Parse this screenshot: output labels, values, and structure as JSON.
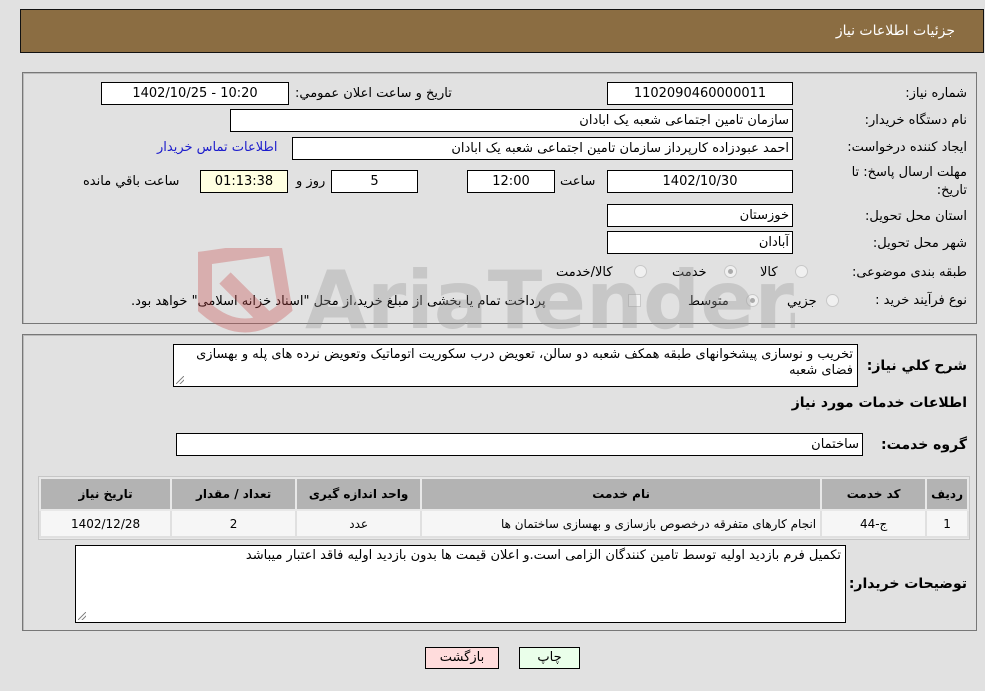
{
  "header": {
    "title": "جزئیات اطلاعات نیاز"
  },
  "form": {
    "need_number": {
      "label": "شماره نیاز:",
      "value": "1102090460000011"
    },
    "announce_datetime": {
      "label": "تاریخ و ساعت اعلان عمومي:",
      "value": "1402/10/25 - 10:20"
    },
    "buyer_org": {
      "label": "نام دستگاه خريدار:",
      "value": "سازمان تامین اجتماعی شعبه یک ابادان"
    },
    "requester": {
      "label": "ایجاد کننده درخواست:",
      "value": "احمد عبودزاده کارپرداز سازمان تامین اجتماعی شعبه یک ابادان"
    },
    "buyer_contact_link": "اطلاعات تماس خریدار",
    "deadline": {
      "label_line1": "مهلت ارسال پاسخ: تا",
      "label_line2": "تاریخ:",
      "date": "1402/10/30",
      "time_label": "ساعت",
      "time": "12:00",
      "days": "5",
      "days_label": "روز و",
      "remaining": "01:13:38",
      "remaining_label": "ساعت باقي مانده"
    },
    "province": {
      "label": "استان محل تحویل:",
      "value": "خوزستان"
    },
    "city": {
      "label": "شهر محل تحویل:",
      "value": "آبادان"
    },
    "category": {
      "label": "طبقه بندی موضوعی:",
      "options": [
        "کالا",
        "خدمت",
        "کالا/خدمت"
      ],
      "selected": "خدمت"
    },
    "process_type": {
      "label": "نوع فرآیند خرید :",
      "options": [
        "جزيي",
        "متوسط"
      ],
      "selected": "متوسط",
      "treasury_checkbox_label": "پرداخت تمام یا بخشی از مبلغ خرید،از محل \"اسناد خزانه اسلامی\" خواهد بود.",
      "treasury_checked": false
    }
  },
  "details": {
    "description_label": "شرح کلي نياز:",
    "description": "تخریب و نوسازی پیشخوانهای طبقه همکف شعبه دو سالن، تعویض درب سکوریت اتوماتیک وتعویض نرده های پله و بهسازی فضای شعبه",
    "services_heading": "اطلاعات خدمات مورد نياز",
    "service_group_label": "گروه خدمت:",
    "service_group": "ساختمان",
    "table": {
      "headers": [
        "ردیف",
        "کد خدمت",
        "نام خدمت",
        "واحد اندازه گیری",
        "تعداد / مقدار",
        "تاریخ نیاز"
      ],
      "rows": [
        [
          "1",
          "ج-44",
          "انجام کارهای متفرقه درخصوص بازسازی و بهسازی ساختمان ها",
          "عدد",
          "2",
          "1402/12/28"
        ]
      ]
    },
    "buyer_notes_label": "توضیحات خریدار:",
    "buyer_notes": "تکمیل فرم بازدید اولیه توسط تامین کنندگان الزامی است.و اعلان قیمت ها بدون بازدید اولیه فاقد اعتبار میباشد"
  },
  "buttons": {
    "print": "چاپ",
    "back": "بازگشت"
  },
  "watermark": {
    "text": "AriaTender.neT"
  },
  "colors": {
    "header_bg": "#8b6d42",
    "print_btn_bg": "#eaffea",
    "back_btn_bg": "#ffdcdc",
    "remaining_bg": "#ffffe1"
  }
}
